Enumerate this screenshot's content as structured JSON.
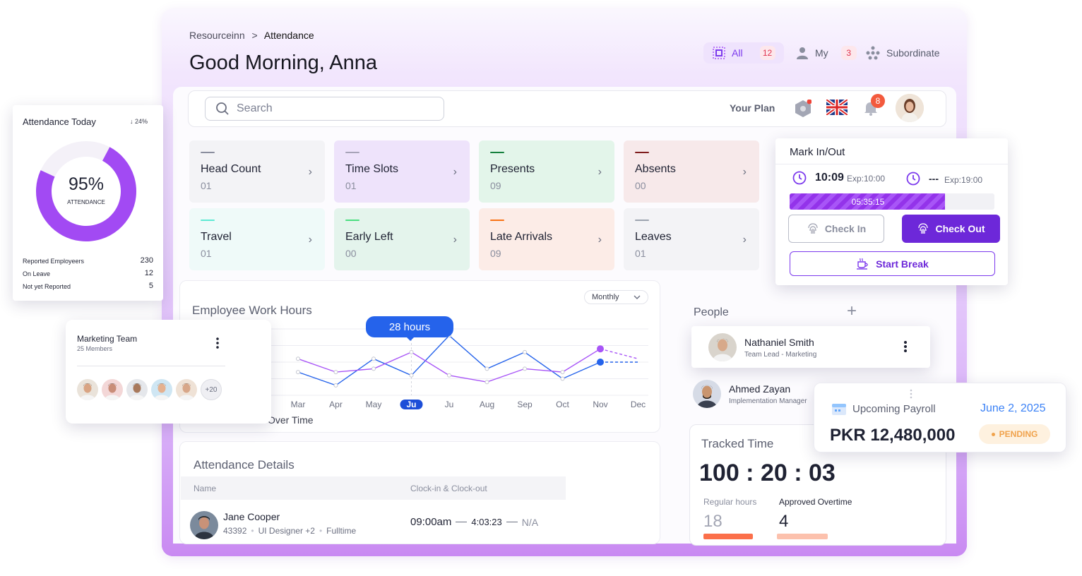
{
  "breadcrumb": {
    "root": "Resourceinn",
    "separator": ">",
    "current": "Attendance"
  },
  "greeting": "Good Morning, Anna",
  "filters": [
    {
      "label": "All",
      "count": "12",
      "icon": "all-icon"
    },
    {
      "label": "My",
      "count": "3",
      "icon": "user-icon"
    },
    {
      "label": "Subordinate",
      "count": "",
      "icon": "subordinate-icon"
    }
  ],
  "topbar": {
    "search_placeholder": "Search",
    "plan_label": "Your Plan",
    "notification_count": "8"
  },
  "stats": [
    {
      "title": "Head Count",
      "value": "01",
      "color": "#8a8e9e",
      "bg": "#f3f3f6"
    },
    {
      "title": "Time Slots",
      "value": "01",
      "color": "#a7a3b8",
      "bg": "#eee3fb"
    },
    {
      "title": "Presents",
      "value": "09",
      "color": "#15803d",
      "bg": "#e3f5ea"
    },
    {
      "title": "Absents",
      "value": "00",
      "color": "#7f1d1d",
      "bg": "#f7e9ea"
    },
    {
      "title": "Travel",
      "value": "01",
      "color": "#5eead4",
      "bg": "#effaf9"
    },
    {
      "title": "Early Left",
      "value": "00",
      "color": "#4ade80",
      "bg": "#e4f4ec"
    },
    {
      "title": "Late Arrivals",
      "value": "09",
      "color": "#f97316",
      "bg": "#fcece7"
    },
    {
      "title": "Leaves",
      "value": "01",
      "color": "#9ca3af",
      "bg": "#f3f3f6"
    }
  ],
  "attendance_today": {
    "title": "Attendance Today",
    "change": "↓ 24%",
    "percent": "95%",
    "percent_value": 95,
    "caption": "ATTENDANCE",
    "rows": [
      {
        "label": "Reported Employeers",
        "value": "230"
      },
      {
        "label": "On Leave",
        "value": "12"
      },
      {
        "label": "Not yet Reported",
        "value": "5"
      }
    ]
  },
  "marketing_team": {
    "title": "Marketing Team",
    "subtitle": "25 Members",
    "more": "+20"
  },
  "work_hours": {
    "title": "Employee Work Hours",
    "period": "Monthly",
    "tooltip": "28 hours",
    "legend_partial": "Over Time",
    "months": [
      "Mar",
      "Apr",
      "May",
      "Ju",
      "Ju",
      "Aug",
      "Sep",
      "Oct",
      "Nov",
      "Dec"
    ],
    "active_month": "Ju"
  },
  "chart_data": {
    "type": "line",
    "categories": [
      "Mar",
      "Apr",
      "May",
      "Ju",
      "Ju",
      "Aug",
      "Sep",
      "Oct",
      "Nov",
      "Dec"
    ],
    "series": [
      {
        "name": "",
        "color": "#2563eb",
        "values": [
          7,
          3,
          11,
          6,
          18,
          8,
          13,
          5,
          10,
          10
        ]
      },
      {
        "name": "Over Time",
        "color": "#a855f7",
        "values": [
          11,
          7,
          8,
          13,
          6,
          4,
          8,
          7,
          14,
          11
        ]
      }
    ],
    "ylim": [
      0,
      20
    ]
  },
  "attendance_details": {
    "title": "Attendance Details",
    "columns": [
      "Name",
      "Clock-in & Clock-out"
    ],
    "rows": [
      {
        "name": "Jane Cooper",
        "id": "43392",
        "role": "UI Designer +2",
        "type": "Fulltime",
        "in": "09:00am",
        "out": "4:03:23",
        "extra": "N/A"
      }
    ]
  },
  "mark_in_out": {
    "title": "Mark In/Out",
    "in_time": "10:09",
    "in_expected": "Exp:10:00",
    "out_time": "---",
    "out_expected": "Exp:19:00",
    "elapsed": "05:35:15",
    "progress": 0.76,
    "check_in": "Check In",
    "check_out": "Check Out",
    "start_break": "Start Break"
  },
  "people": {
    "title": "People",
    "members": [
      {
        "name": "Nathaniel Smith",
        "role": "Team Lead - Marketing"
      },
      {
        "name": "Ahmed Zayan",
        "role": "Implementation Manager"
      }
    ]
  },
  "payroll": {
    "title": "Upcoming Payroll",
    "date": "June 2, 2025",
    "amount": "PKR 12,480,000",
    "status": "PENDING"
  },
  "tracked_time": {
    "title": "Tracked Time",
    "time": "100 : 20 : 03",
    "regular_label": "Regular hours",
    "regular_value": "18",
    "overtime_label": "Approved Overtime",
    "overtime_value": "4"
  }
}
